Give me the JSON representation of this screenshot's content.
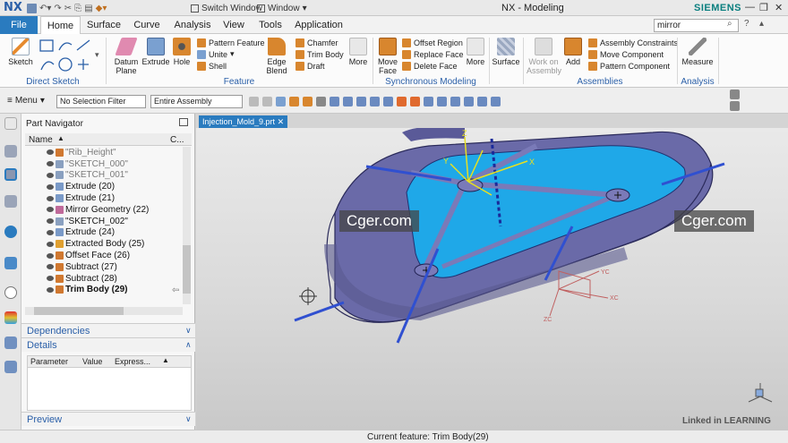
{
  "app": {
    "logo": "NX",
    "window_title": "NX - Modeling",
    "brand": "SIEMENS",
    "switch_window": "Switch Window",
    "window_menu": "Window"
  },
  "tabs": [
    "File",
    "Home",
    "Surface",
    "Curve",
    "Analysis",
    "View",
    "Tools",
    "Application"
  ],
  "search": {
    "value": "mirror"
  },
  "ribbon": {
    "groups": {
      "direct_sketch": "Direct Sketch",
      "feature": "Feature",
      "synchronous": "Synchronous Modeling",
      "assemblies": "Assemblies",
      "analysis": "Analysis"
    },
    "sketch": "Sketch",
    "datum_plane": "Datum Plane",
    "extrude": "Extrude",
    "hole": "Hole",
    "pattern_feature": "Pattern Feature",
    "unite": "Unite",
    "shell": "Shell",
    "edge_blend": "Edge Blend",
    "chamfer": "Chamfer",
    "trim_body": "Trim Body",
    "draft": "Draft",
    "more1": "More",
    "move_face": "Move Face",
    "offset_region": "Offset Region",
    "replace_face": "Replace Face",
    "delete_face": "Delete Face",
    "more2": "More",
    "surface": "Surface",
    "work_on_assembly": "Work on Assembly",
    "add": "Add",
    "assembly_constraints": "Assembly Constraints",
    "move_component": "Move Component",
    "pattern_component": "Pattern Component",
    "measure": "Measure"
  },
  "toolbar": {
    "menu": "Menu",
    "selection_filter": "No Selection Filter",
    "assembly_scope": "Entire Assembly"
  },
  "navigator": {
    "title": "Part Navigator",
    "col_name": "Name",
    "col_c": "C...",
    "rows": [
      {
        "label": "\"Rib_Height\"",
        "style": "grey"
      },
      {
        "label": "\"SKETCH_000\"",
        "style": "grey"
      },
      {
        "label": "\"SKETCH_001\"",
        "style": "grey"
      },
      {
        "label": "Extrude (20)",
        "style": ""
      },
      {
        "label": "Extrude (21)",
        "style": ""
      },
      {
        "label": "Mirror Geometry (22)",
        "style": ""
      },
      {
        "label": "\"SKETCH_002\"",
        "style": ""
      },
      {
        "label": "Extrude (24)",
        "style": ""
      },
      {
        "label": "Extracted Body (25)",
        "style": ""
      },
      {
        "label": "Offset Face (26)",
        "style": ""
      },
      {
        "label": "Subtract (27)",
        "style": ""
      },
      {
        "label": "Subtract (28)",
        "style": ""
      },
      {
        "label": "Trim Body (29)",
        "style": "bold"
      }
    ],
    "dependencies": "Dependencies",
    "details": "Details",
    "det_cols": [
      "Parameter",
      "Value",
      "Express..."
    ],
    "preview": "Preview"
  },
  "viewport": {
    "tab": "Injection_Mold_9.prt",
    "watermark": "Cger.com",
    "axis_x": "X",
    "axis_y": "Y",
    "axis_z": "Z",
    "xc": "XC",
    "yc": "YC",
    "zc": "ZC"
  },
  "status": {
    "text": "Current feature: Trim Body(29)",
    "linkedin": "Linked in LEARNING"
  },
  "colors": {
    "accent": "#2a7bbf",
    "part": "#6a6aa8",
    "cavity": "#1fa8e8",
    "axis": "#3050d0"
  }
}
